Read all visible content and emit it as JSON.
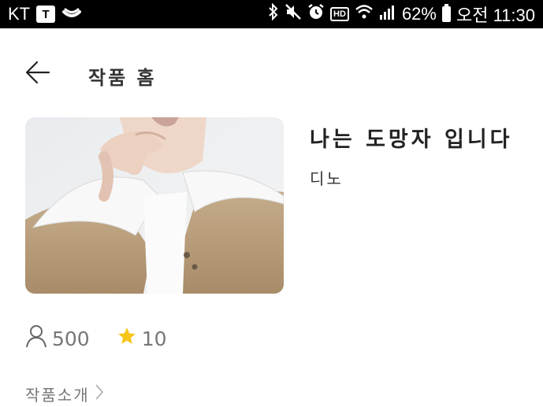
{
  "status_bar": {
    "carrier": "KT",
    "carrier_app_letter": "T",
    "hd_label": "HD",
    "battery": "62%",
    "time": "오전 11:30"
  },
  "header": {
    "back_icon": "arrow-left-icon",
    "title": "작품 홈"
  },
  "work": {
    "title": "나는 도망자 입니다",
    "author": "디노"
  },
  "stats": {
    "views_icon": "person-icon",
    "views": "500",
    "rating_icon": "star-icon",
    "rating": "10",
    "star_color": "#f5c518"
  },
  "intro": {
    "label": "작품소개",
    "chevron_icon": "chevron-right-icon"
  }
}
